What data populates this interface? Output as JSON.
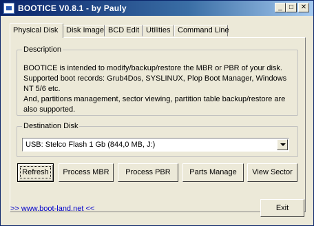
{
  "window": {
    "title": "BOOTICE V0.8.1 - by Pauly"
  },
  "tabs": [
    "Physical Disk",
    "Disk Image",
    "BCD Edit",
    "Utilities",
    "Command Line"
  ],
  "description": {
    "label": "Description",
    "lines": [
      "BOOTICE is intended to modify/backup/restore the MBR or PBR of your disk.",
      "Supported boot records: Grub4Dos, SYSLINUX, Plop Boot Manager, Windows",
      "NT 5/6 etc.",
      "And, partitions management, sector viewing, partition table backup/restore are",
      "also supported."
    ]
  },
  "destination": {
    "label": "Destination Disk",
    "selected": "USB: Stelco  Flash 1 Gb (844,0 MB, J:)"
  },
  "buttons": {
    "refresh": "Refresh",
    "process_mbr": "Process MBR",
    "process_pbr": "Process PBR",
    "parts_manage": "Parts Manage",
    "view_sector": "View Sector",
    "exit": "Exit"
  },
  "footer": {
    "link": ">> www.boot-land.net <<"
  }
}
